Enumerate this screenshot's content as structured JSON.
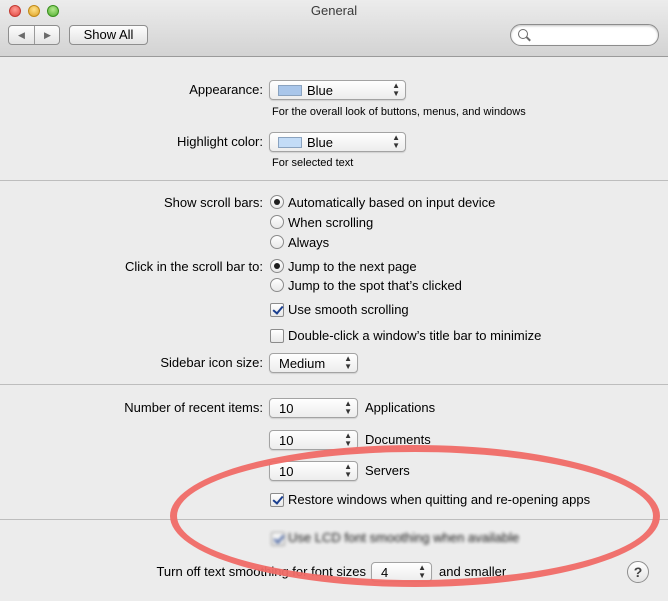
{
  "window": {
    "title": "General"
  },
  "toolbar": {
    "back": "◀",
    "forward": "▶",
    "show_all": "Show All",
    "search_placeholder": "",
    "search_value": ""
  },
  "appearance": {
    "label": "Appearance:",
    "value": "Blue",
    "swatch_color": "#a9c6ea",
    "hint": "For the overall look of buttons, menus, and windows"
  },
  "highlight": {
    "label": "Highlight color:",
    "value": "Blue",
    "swatch_color": "#c3dcf7",
    "hint": "For selected text"
  },
  "scroll_bars": {
    "label": "Show scroll bars:",
    "options": [
      "Automatically based on input device",
      "When scrolling",
      "Always"
    ],
    "selected": 0
  },
  "click_scroll": {
    "label": "Click in the scroll bar to:",
    "options": [
      "Jump to the next page",
      "Jump to the spot that’s clicked"
    ],
    "selected": 0
  },
  "smooth_scrolling": {
    "label": "Use smooth scrolling",
    "checked": true
  },
  "double_click": {
    "label": "Double-click a window’s title bar to minimize",
    "checked": false
  },
  "sidebar": {
    "label": "Sidebar icon size:",
    "value": "Medium"
  },
  "recent": {
    "label": "Number of recent items:",
    "applications": {
      "value": "10",
      "label": "Applications"
    },
    "documents": {
      "value": "10",
      "label": "Documents"
    },
    "servers": {
      "value": "10",
      "label": "Servers"
    }
  },
  "restore_windows": {
    "label": "Restore windows when quitting and re-opening apps",
    "checked": true
  },
  "lcd_smoothing": {
    "label": "Use LCD font smoothing when available",
    "checked": true
  },
  "text_smoothing": {
    "label": "Turn off text smoothing for font sizes",
    "value": "4",
    "suffix": "and smaller"
  },
  "help": {
    "label": "?"
  },
  "annotation": {
    "color": "#f06b67"
  }
}
